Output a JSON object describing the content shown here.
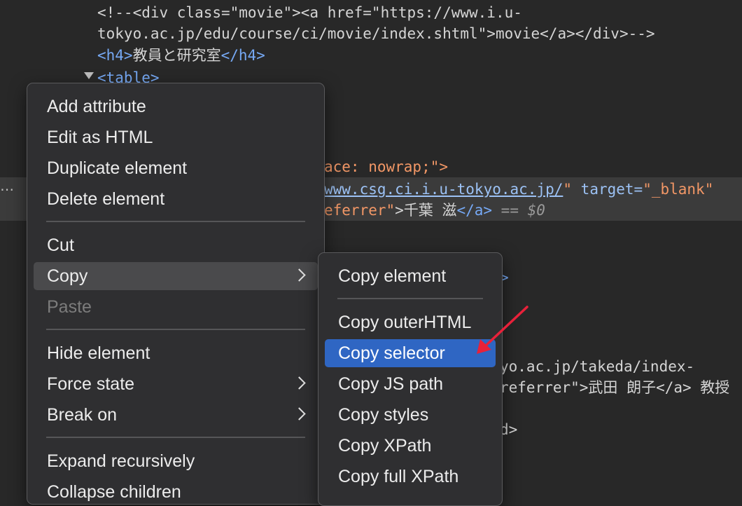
{
  "code": {
    "line1": "<!--<div class=\"movie\"><a href=\"https://www.i.u-",
    "line2": "tokyo.ac.jp/edu/course/ci/movie/index.shtml\">movie</a></div>-->",
    "h4_open": "<h4>",
    "h4_text": "教員と研究室",
    "h4_close": "</h4>",
    "table_open": "<table>",
    "nowrap_frag": "ace: nowrap;\">",
    "url_frag": "www.csg.ci.i.u-tokyo.ac.jp/",
    "quote_frag": "\"",
    "target_attr": " target=",
    "target_val": "\"_blank\"",
    "referrer_frag": "eferrer\"",
    "name_frag": ">千葉 滋",
    "a_close": "</a>",
    "eq_sel": " == $0",
    "gt_frag": ">",
    "takeda_url": "yo.ac.jp/takeda/index-",
    "takeda_line": "referrer\">武田 朗子</a> 教授",
    "d_close": "d>"
  },
  "context_menu": {
    "items": [
      {
        "label": "Add attribute"
      },
      {
        "label": "Edit as HTML"
      },
      {
        "label": "Duplicate element"
      },
      {
        "label": "Delete element"
      },
      {
        "label": "Cut"
      },
      {
        "label": "Copy"
      },
      {
        "label": "Paste"
      },
      {
        "label": "Hide element"
      },
      {
        "label": "Force state"
      },
      {
        "label": "Break on"
      },
      {
        "label": "Expand recursively"
      },
      {
        "label": "Collapse children"
      }
    ]
  },
  "copy_submenu": {
    "items": [
      {
        "label": "Copy element"
      },
      {
        "label": "Copy outerHTML"
      },
      {
        "label": "Copy selector"
      },
      {
        "label": "Copy JS path"
      },
      {
        "label": "Copy styles"
      },
      {
        "label": "Copy XPath"
      },
      {
        "label": "Copy full XPath"
      }
    ]
  },
  "colors": {
    "selected_bg": "#2f66c3",
    "annotation_arrow": "#e8213a"
  }
}
